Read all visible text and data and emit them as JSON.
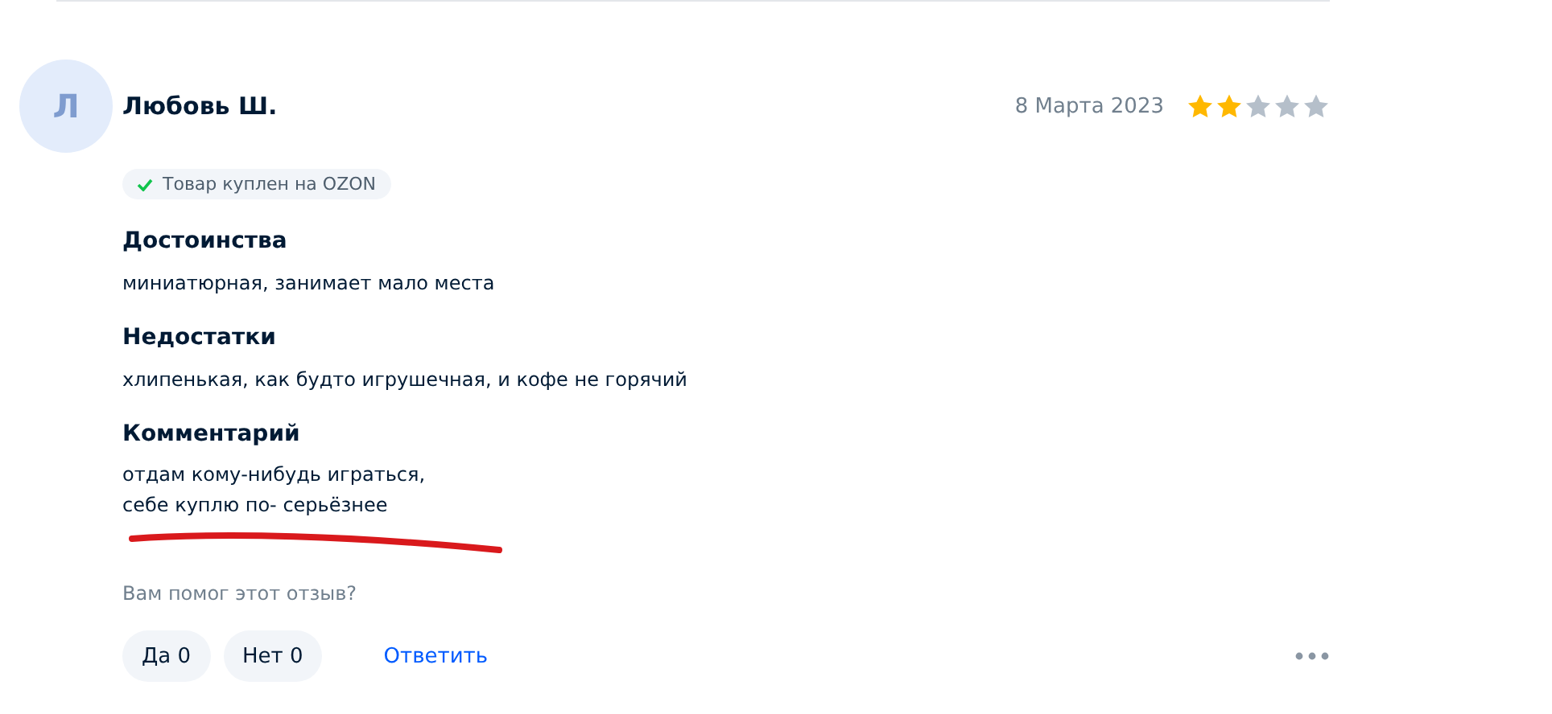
{
  "review": {
    "avatar_letter": "Л",
    "author": "Любовь Ш.",
    "date": "8 Марта 2023",
    "stars": 2,
    "badge": "Товар куплен на OZON",
    "sections": [
      {
        "heading": "Достоинства",
        "lines": [
          "миниатюрная, занимает мало места"
        ]
      },
      {
        "heading": "Недостатки",
        "lines": [
          "хлипенькая, как будто игрушечная, и кофе не горячий"
        ]
      },
      {
        "heading": "Комментарий",
        "lines": [
          "отдам кому-нибудь играться,",
          "себе куплю по- серьёзнее"
        ]
      }
    ],
    "helpful_question": "Вам помог этот отзыв?",
    "votes": [
      {
        "label": "Да 0"
      },
      {
        "label": "Нет 0"
      }
    ],
    "reply_link": "Ответить"
  }
}
